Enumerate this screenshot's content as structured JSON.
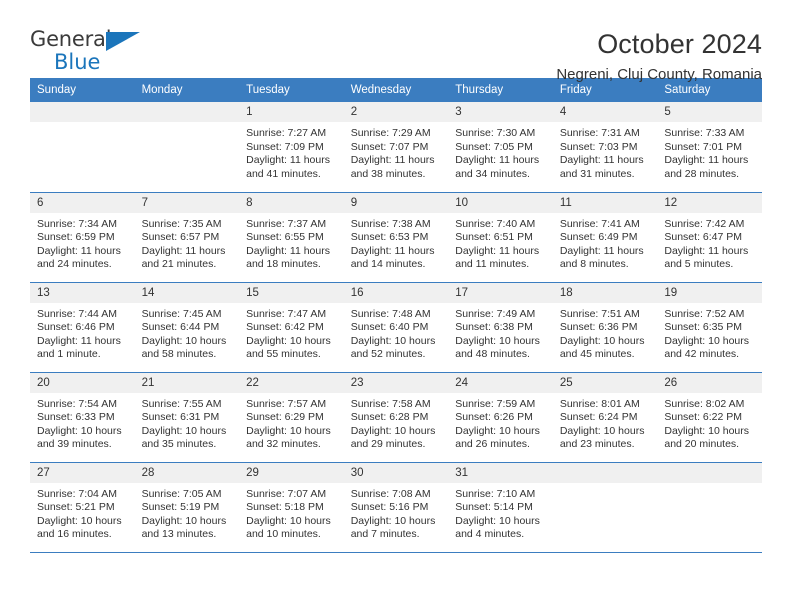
{
  "brand": {
    "name_top": "General",
    "name_bottom": "Blue",
    "accent_color": "#1b75bb"
  },
  "header": {
    "title": "October 2024",
    "subtitle": "Negreni, Cluj County, Romania"
  },
  "calendar": {
    "header_bg": "#3b7dc0",
    "daynum_bg": "#f0f0f0",
    "weekday_headers": [
      "Sunday",
      "Monday",
      "Tuesday",
      "Wednesday",
      "Thursday",
      "Friday",
      "Saturday"
    ],
    "weeks": [
      [
        {
          "day": "",
          "lines": []
        },
        {
          "day": "",
          "lines": []
        },
        {
          "day": "1",
          "lines": [
            "Sunrise: 7:27 AM",
            "Sunset: 7:09 PM",
            "Daylight: 11 hours",
            "and 41 minutes."
          ]
        },
        {
          "day": "2",
          "lines": [
            "Sunrise: 7:29 AM",
            "Sunset: 7:07 PM",
            "Daylight: 11 hours",
            "and 38 minutes."
          ]
        },
        {
          "day": "3",
          "lines": [
            "Sunrise: 7:30 AM",
            "Sunset: 7:05 PM",
            "Daylight: 11 hours",
            "and 34 minutes."
          ]
        },
        {
          "day": "4",
          "lines": [
            "Sunrise: 7:31 AM",
            "Sunset: 7:03 PM",
            "Daylight: 11 hours",
            "and 31 minutes."
          ]
        },
        {
          "day": "5",
          "lines": [
            "Sunrise: 7:33 AM",
            "Sunset: 7:01 PM",
            "Daylight: 11 hours",
            "and 28 minutes."
          ]
        }
      ],
      [
        {
          "day": "6",
          "lines": [
            "Sunrise: 7:34 AM",
            "Sunset: 6:59 PM",
            "Daylight: 11 hours",
            "and 24 minutes."
          ]
        },
        {
          "day": "7",
          "lines": [
            "Sunrise: 7:35 AM",
            "Sunset: 6:57 PM",
            "Daylight: 11 hours",
            "and 21 minutes."
          ]
        },
        {
          "day": "8",
          "lines": [
            "Sunrise: 7:37 AM",
            "Sunset: 6:55 PM",
            "Daylight: 11 hours",
            "and 18 minutes."
          ]
        },
        {
          "day": "9",
          "lines": [
            "Sunrise: 7:38 AM",
            "Sunset: 6:53 PM",
            "Daylight: 11 hours",
            "and 14 minutes."
          ]
        },
        {
          "day": "10",
          "lines": [
            "Sunrise: 7:40 AM",
            "Sunset: 6:51 PM",
            "Daylight: 11 hours",
            "and 11 minutes."
          ]
        },
        {
          "day": "11",
          "lines": [
            "Sunrise: 7:41 AM",
            "Sunset: 6:49 PM",
            "Daylight: 11 hours",
            "and 8 minutes."
          ]
        },
        {
          "day": "12",
          "lines": [
            "Sunrise: 7:42 AM",
            "Sunset: 6:47 PM",
            "Daylight: 11 hours",
            "and 5 minutes."
          ]
        }
      ],
      [
        {
          "day": "13",
          "lines": [
            "Sunrise: 7:44 AM",
            "Sunset: 6:46 PM",
            "Daylight: 11 hours",
            "and 1 minute."
          ]
        },
        {
          "day": "14",
          "lines": [
            "Sunrise: 7:45 AM",
            "Sunset: 6:44 PM",
            "Daylight: 10 hours",
            "and 58 minutes."
          ]
        },
        {
          "day": "15",
          "lines": [
            "Sunrise: 7:47 AM",
            "Sunset: 6:42 PM",
            "Daylight: 10 hours",
            "and 55 minutes."
          ]
        },
        {
          "day": "16",
          "lines": [
            "Sunrise: 7:48 AM",
            "Sunset: 6:40 PM",
            "Daylight: 10 hours",
            "and 52 minutes."
          ]
        },
        {
          "day": "17",
          "lines": [
            "Sunrise: 7:49 AM",
            "Sunset: 6:38 PM",
            "Daylight: 10 hours",
            "and 48 minutes."
          ]
        },
        {
          "day": "18",
          "lines": [
            "Sunrise: 7:51 AM",
            "Sunset: 6:36 PM",
            "Daylight: 10 hours",
            "and 45 minutes."
          ]
        },
        {
          "day": "19",
          "lines": [
            "Sunrise: 7:52 AM",
            "Sunset: 6:35 PM",
            "Daylight: 10 hours",
            "and 42 minutes."
          ]
        }
      ],
      [
        {
          "day": "20",
          "lines": [
            "Sunrise: 7:54 AM",
            "Sunset: 6:33 PM",
            "Daylight: 10 hours",
            "and 39 minutes."
          ]
        },
        {
          "day": "21",
          "lines": [
            "Sunrise: 7:55 AM",
            "Sunset: 6:31 PM",
            "Daylight: 10 hours",
            "and 35 minutes."
          ]
        },
        {
          "day": "22",
          "lines": [
            "Sunrise: 7:57 AM",
            "Sunset: 6:29 PM",
            "Daylight: 10 hours",
            "and 32 minutes."
          ]
        },
        {
          "day": "23",
          "lines": [
            "Sunrise: 7:58 AM",
            "Sunset: 6:28 PM",
            "Daylight: 10 hours",
            "and 29 minutes."
          ]
        },
        {
          "day": "24",
          "lines": [
            "Sunrise: 7:59 AM",
            "Sunset: 6:26 PM",
            "Daylight: 10 hours",
            "and 26 minutes."
          ]
        },
        {
          "day": "25",
          "lines": [
            "Sunrise: 8:01 AM",
            "Sunset: 6:24 PM",
            "Daylight: 10 hours",
            "and 23 minutes."
          ]
        },
        {
          "day": "26",
          "lines": [
            "Sunrise: 8:02 AM",
            "Sunset: 6:22 PM",
            "Daylight: 10 hours",
            "and 20 minutes."
          ]
        }
      ],
      [
        {
          "day": "27",
          "lines": [
            "Sunrise: 7:04 AM",
            "Sunset: 5:21 PM",
            "Daylight: 10 hours",
            "and 16 minutes."
          ]
        },
        {
          "day": "28",
          "lines": [
            "Sunrise: 7:05 AM",
            "Sunset: 5:19 PM",
            "Daylight: 10 hours",
            "and 13 minutes."
          ]
        },
        {
          "day": "29",
          "lines": [
            "Sunrise: 7:07 AM",
            "Sunset: 5:18 PM",
            "Daylight: 10 hours",
            "and 10 minutes."
          ]
        },
        {
          "day": "30",
          "lines": [
            "Sunrise: 7:08 AM",
            "Sunset: 5:16 PM",
            "Daylight: 10 hours",
            "and 7 minutes."
          ]
        },
        {
          "day": "31",
          "lines": [
            "Sunrise: 7:10 AM",
            "Sunset: 5:14 PM",
            "Daylight: 10 hours",
            "and 4 minutes."
          ]
        },
        {
          "day": "",
          "lines": []
        },
        {
          "day": "",
          "lines": []
        }
      ]
    ]
  }
}
